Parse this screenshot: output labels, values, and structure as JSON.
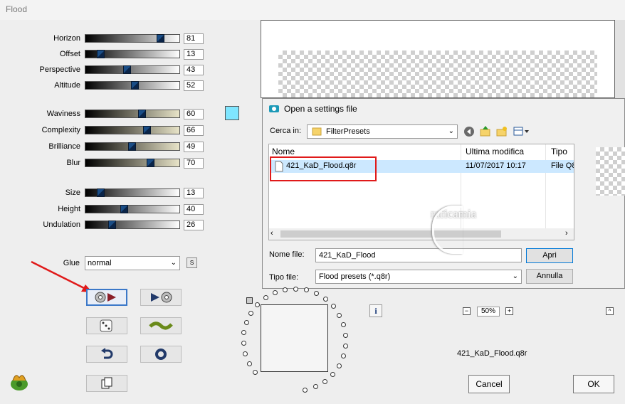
{
  "window": {
    "title": "Flood"
  },
  "sliders": [
    {
      "label": "Horizon",
      "value": "81",
      "pos": 0.81
    },
    {
      "label": "Offset",
      "value": "13",
      "pos": 0.13
    },
    {
      "label": "Perspective",
      "value": "43",
      "pos": 0.43
    },
    {
      "label": "Altitude",
      "value": "52",
      "pos": 0.52
    },
    {
      "label": "Waviness",
      "value": "60",
      "pos": 0.6
    },
    {
      "label": "Complexity",
      "value": "66",
      "pos": 0.66
    },
    {
      "label": "Brilliance",
      "value": "49",
      "pos": 0.49
    },
    {
      "label": "Blur",
      "value": "70",
      "pos": 0.7
    },
    {
      "label": "Size",
      "value": "13",
      "pos": 0.13
    },
    {
      "label": "Height",
      "value": "40",
      "pos": 0.4
    },
    {
      "label": "Undulation",
      "value": "26",
      "pos": 0.26
    }
  ],
  "color_swatch": "#7fe6ff",
  "glue": {
    "label": "Glue",
    "value": "normal",
    "s_button": "S"
  },
  "dialog": {
    "title": "Open a settings file",
    "look_in_label": "Cerca in:",
    "look_in_value": "FilterPresets",
    "columns": {
      "name": "Nome",
      "modified": "Ultima modifica",
      "type": "Tipo"
    },
    "file": {
      "name": "421_KaD_Flood.q8r",
      "modified": "11/07/2017 10:17",
      "type": "File Q8"
    },
    "filename_label": "Nome file:",
    "filename_value": "421_KaD_Flood",
    "filetype_label": "Tipo file:",
    "filetype_value": "Flood presets (*.q8r)",
    "open_button": "Apri",
    "cancel_button": "Annulla"
  },
  "watermark": "raficamia",
  "zoom": {
    "value": "50%",
    "minus": "−",
    "plus": "+"
  },
  "preset_name": "421_KaD_Flood.q8r",
  "buttons": {
    "cancel": "Cancel",
    "ok": "OK"
  },
  "colors": {
    "annotation_red": "#e01a1a",
    "selection": "#cce8ff",
    "thumb": "#1a4d86"
  }
}
